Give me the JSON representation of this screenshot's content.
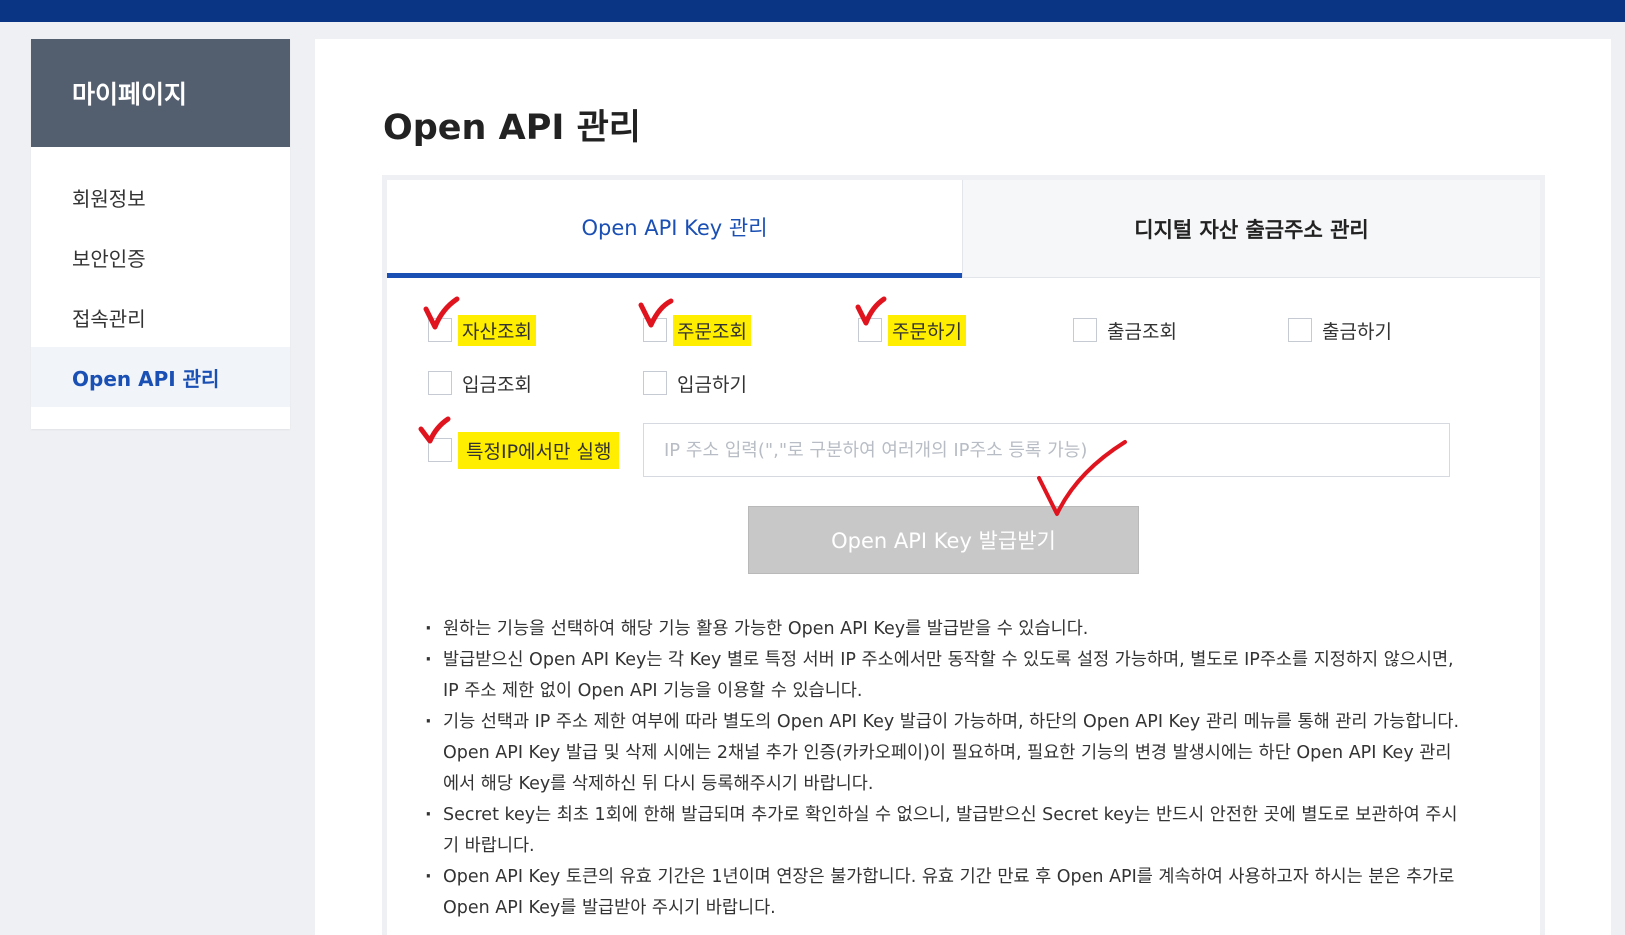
{
  "sidebar": {
    "title": "마이페이지",
    "items": [
      {
        "label": "회원정보"
      },
      {
        "label": "보안인증"
      },
      {
        "label": "접속관리"
      },
      {
        "label": "Open API 관리"
      }
    ]
  },
  "page": {
    "title": "Open API 관리"
  },
  "tabs": [
    {
      "label": "Open API Key 관리"
    },
    {
      "label": "디지털 자산 출금주소 관리"
    }
  ],
  "permissions": [
    {
      "label": "자산조회"
    },
    {
      "label": "주문조회"
    },
    {
      "label": "주문하기"
    },
    {
      "label": "출금조회"
    },
    {
      "label": "출금하기"
    },
    {
      "label": "입금조회"
    },
    {
      "label": "입금하기"
    }
  ],
  "ip_restrict": {
    "label": "특정IP에서만 실행",
    "placeholder": "IP 주소 입력(\",\"로 구분하여 여러개의 IP주소 등록 가능)"
  },
  "issue_button": {
    "label": "Open API Key 발급받기"
  },
  "notes": [
    "원하는 기능을 선택하여 해당 기능 활용 가능한 Open API Key를 발급받을 수 있습니다.",
    "발급받으신 Open API Key는 각 Key 별로 특정 서버 IP 주소에서만 동작할 수 있도록 설정 가능하며, 별도로 IP주소를 지정하지 않으시면, IP 주소 제한 없이 Open API 기능을 이용할 수 있습니다.",
    "기능 선택과 IP 주소 제한 여부에 따라 별도의 Open API Key 발급이 가능하며, 하단의 Open API Key 관리 메뉴를 통해 관리 가능합니다. Open API Key 발급 및 삭제 시에는 2채널 추가 인증(카카오페이)이 필요하며, 필요한 기능의 변경 발생시에는 하단 Open API Key 관리에서 해당 Key를 삭제하신 뒤 다시 등록해주시기 바랍니다.",
    "Secret key는 최초 1회에 한해 발급되며 추가로 확인하실 수 없으니, 발급받으신 Secret key는 반드시 안전한 곳에 별도로 보관하여 주시기 바랍니다.",
    "Open API Key 토큰의 유효 기간은 1년이며 연장은 불가합니다. 유효 기간 만료 후 Open API를 계속하여 사용하고자 하시는 분은 추가로 Open API Key를 발급받아 주시기 바랍니다."
  ],
  "colors": {
    "topbar": "#0a3585",
    "accent": "#1a4fb4",
    "sidebar_header": "#535e6f",
    "highlight": "#ffee00",
    "annotation_red": "#e0141e",
    "button_disabled": "#c8c8c8"
  },
  "icons": {
    "annotation": "red-checkmark-icon"
  }
}
